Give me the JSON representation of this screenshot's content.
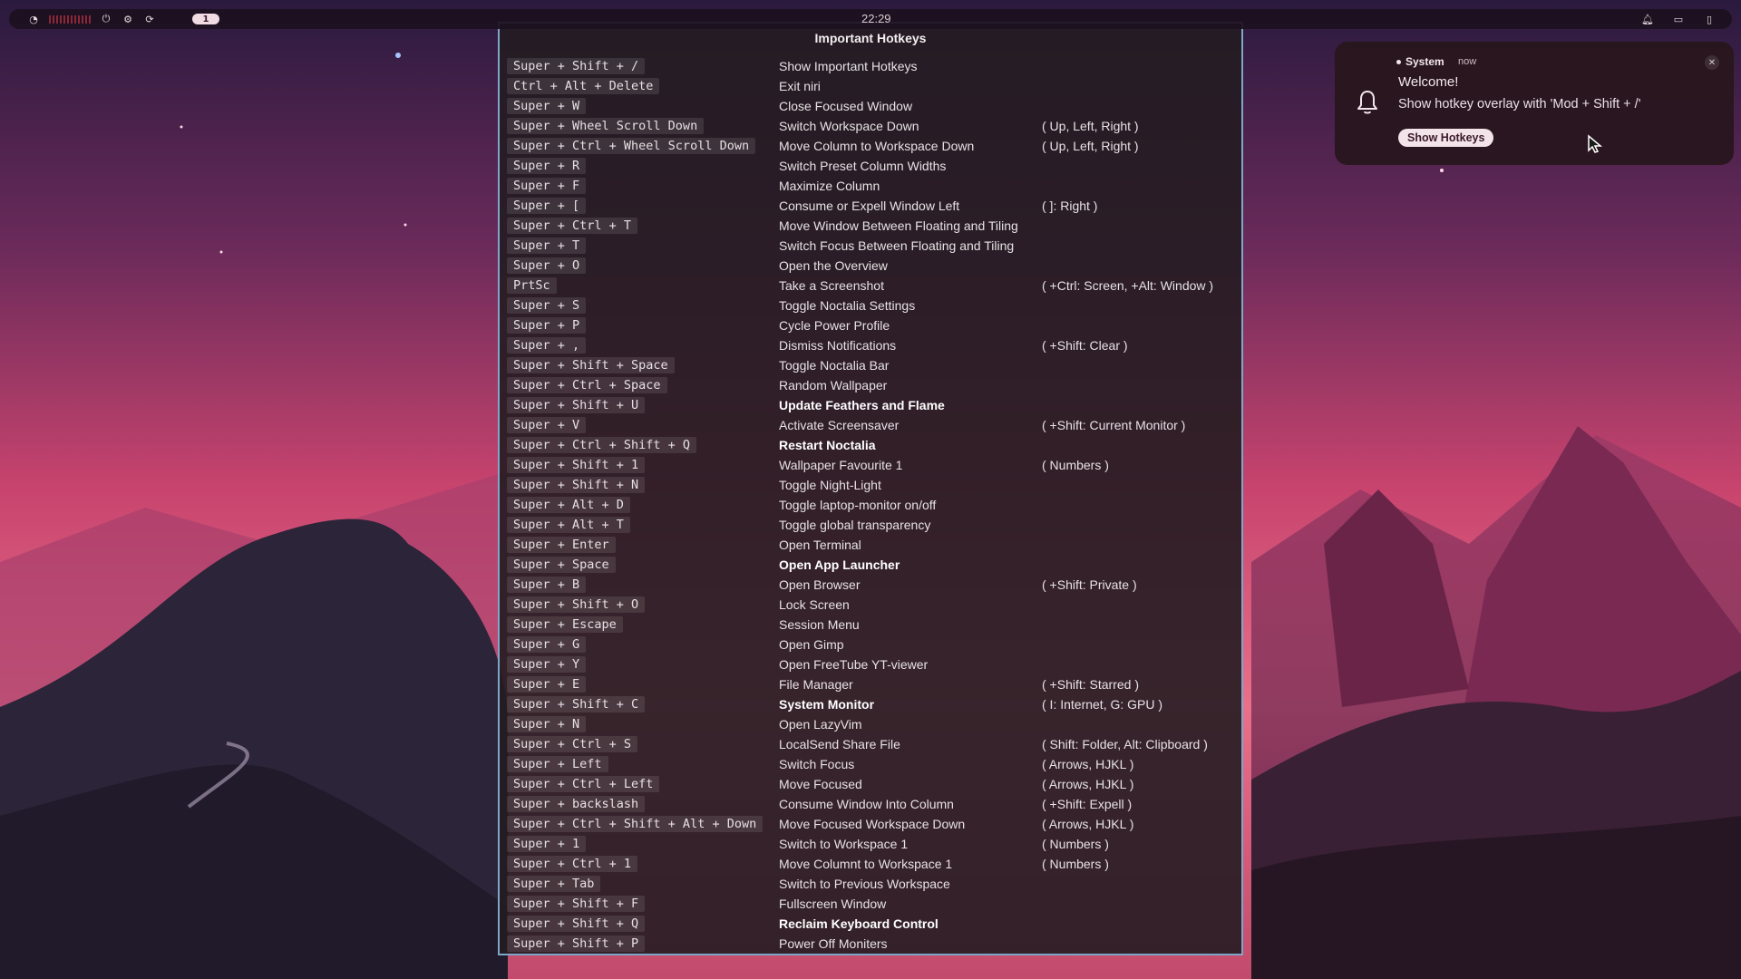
{
  "topbar": {
    "clock": "22:29",
    "workspace_indicator": "1",
    "left_icons": [
      "power-icon",
      "settings-icon",
      "refresh-icon"
    ],
    "right_icons": [
      "bell-icon",
      "tray-icon",
      "battery-icon"
    ]
  },
  "hotkeys": {
    "title": "Important Hotkeys",
    "rows": [
      {
        "key": "Super + Shift + /",
        "desc": "Show Important Hotkeys"
      },
      {
        "key": "Ctrl + Alt + Delete",
        "desc": "Exit niri"
      },
      {
        "key": "Super + W",
        "desc": "Close Focused Window"
      },
      {
        "key": "Super + Wheel Scroll Down",
        "desc": "Switch Workspace Down",
        "note": "( Up, Left, Right )"
      },
      {
        "key": "Super + Ctrl + Wheel Scroll Down",
        "desc": "Move Column to Workspace Down",
        "note": "( Up, Left, Right )"
      },
      {
        "key": "Super + R",
        "desc": "Switch Preset Column Widths"
      },
      {
        "key": "Super + F",
        "desc": "Maximize Column"
      },
      {
        "key": "Super + [",
        "desc": "Consume or Expell Window Left",
        "note": "( ]: Right )"
      },
      {
        "key": "Super + Ctrl + T",
        "desc": "Move Window Between Floating and Tiling"
      },
      {
        "key": "Super + T",
        "desc": "Switch Focus Between Floating and Tiling"
      },
      {
        "key": "Super + O",
        "desc": "Open the Overview"
      },
      {
        "key": "PrtSc",
        "desc": "Take a Screenshot",
        "note": "( +Ctrl: Screen, +Alt: Window )"
      },
      {
        "key": "Super + S",
        "desc": "Toggle Noctalia Settings"
      },
      {
        "key": "Super + P",
        "desc": "Cycle Power Profile"
      },
      {
        "key": "Super + ,",
        "desc": "Dismiss Notifications",
        "note": "( +Shift: Clear )"
      },
      {
        "key": "Super + Shift + Space",
        "desc": "Toggle Noctalia Bar"
      },
      {
        "key": "Super + Ctrl + Space",
        "desc": "Random Wallpaper"
      },
      {
        "key": "Super + Shift + U",
        "desc": "Update Feathers and Flame",
        "bold": true
      },
      {
        "key": "Super + V",
        "desc": "Activate Screensaver",
        "note": "( +Shift: Current Monitor )"
      },
      {
        "key": "Super + Ctrl + Shift + Q",
        "desc": "Restart Noctalia",
        "bold": true
      },
      {
        "key": "Super + Shift + 1",
        "desc": "Wallpaper Favourite 1",
        "note": "( Numbers )"
      },
      {
        "key": "Super + Shift + N",
        "desc": "Toggle Night-Light"
      },
      {
        "key": "Super + Alt + D",
        "desc": "Toggle laptop-monitor on/off"
      },
      {
        "key": "Super + Alt + T",
        "desc": "Toggle global transparency"
      },
      {
        "key": "Super + Enter",
        "desc": "Open Terminal"
      },
      {
        "key": "Super + Space",
        "desc": "Open App Launcher",
        "bold": true
      },
      {
        "key": "Super + B",
        "desc": "Open Browser",
        "note": "( +Shift: Private )"
      },
      {
        "key": "Super + Shift + O",
        "desc": "Lock Screen"
      },
      {
        "key": "Super + Escape",
        "desc": "Session Menu"
      },
      {
        "key": "Super + G",
        "desc": "Open Gimp"
      },
      {
        "key": "Super + Y",
        "desc": "Open FreeTube YT-viewer"
      },
      {
        "key": "Super + E",
        "desc": "File Manager",
        "note": "( +Shift: Starred )"
      },
      {
        "key": "Super + Shift + C",
        "desc": "System Monitor",
        "bold": true,
        "note": "( I: Internet, G: GPU )"
      },
      {
        "key": "Super + N",
        "desc": "Open LazyVim"
      },
      {
        "key": "Super + Ctrl + S",
        "desc": "LocalSend Share File",
        "note": "( Shift: Folder, Alt: Clipboard )"
      },
      {
        "key": "Super + Left",
        "desc": "Switch Focus",
        "note": "( Arrows, HJKL )"
      },
      {
        "key": "Super + Ctrl + Left",
        "desc": "Move Focused",
        "note": "( Arrows, HJKL )"
      },
      {
        "key": "Super + backslash",
        "desc": "Consume Window Into Column",
        "note": "( +Shift: Expell )"
      },
      {
        "key": "Super + Ctrl + Shift + Alt + Down",
        "desc": "Move Focused Workspace Down",
        "note": "( Arrows, HJKL )"
      },
      {
        "key": "Super + 1",
        "desc": "Switch to Workspace 1",
        "note": "( Numbers )"
      },
      {
        "key": "Super + Ctrl + 1",
        "desc": "Move Columnt to Workspace 1",
        "note": "( Numbers )"
      },
      {
        "key": "Super + Tab",
        "desc": "Switch to Previous Workspace"
      },
      {
        "key": "Super + Shift + F",
        "desc": "Fullscreen Window"
      },
      {
        "key": "Super + Shift + Q",
        "desc": "Reclaim Keyboard Control",
        "bold": true
      },
      {
        "key": "Super + Shift + P",
        "desc": "Power Off Moniters"
      }
    ]
  },
  "notification": {
    "source": "System",
    "time": "now",
    "title": "Welcome!",
    "body": "Show hotkey overlay with 'Mod + Shift + /'",
    "action_label": "Show Hotkeys",
    "icon": "bell-icon",
    "close_icon": "close-icon"
  }
}
